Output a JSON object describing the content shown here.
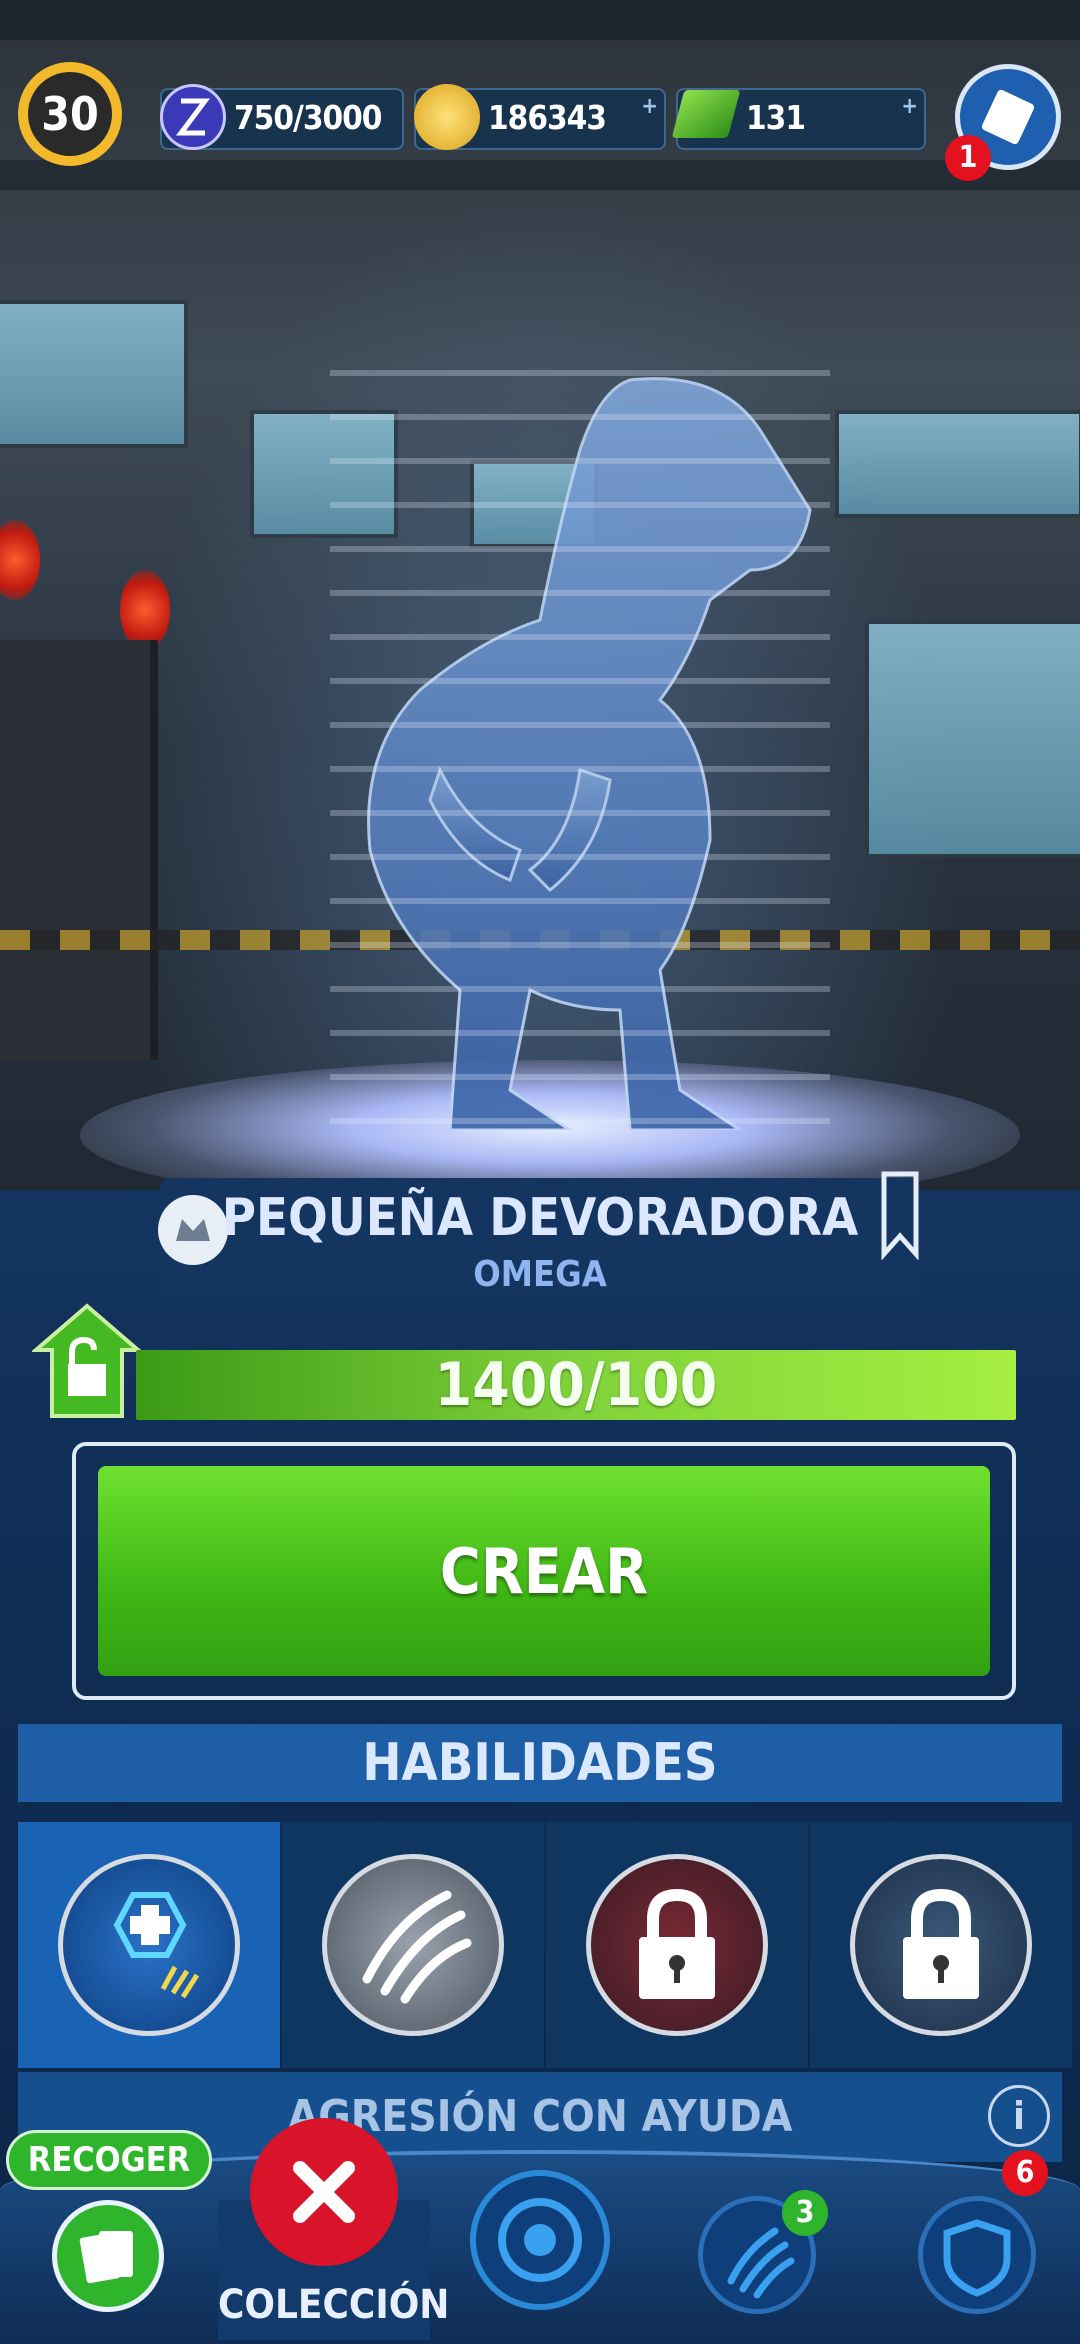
{
  "hud": {
    "level": "30",
    "dna": "750/3000",
    "coins": "186343",
    "cash": "131",
    "ticket_badge": "1"
  },
  "creature": {
    "name": "PEQUEÑA DEVORADORA",
    "rarity": "OMEGA"
  },
  "progress": {
    "text": "1400/100",
    "fraction": 1.0
  },
  "actions": {
    "create_label": "CREAR"
  },
  "abilities": {
    "header": "HABILIDADES",
    "selected_name": "AGRESIÓN CON AYUDA"
  },
  "bottom_nav": {
    "collect_label": "RECOGER",
    "collection_label": "COLECCIÓN",
    "battle_badge": "3",
    "shield_badge": "6"
  },
  "colors": {
    "accent_green": "#5ed122",
    "panel_blue": "#133560",
    "badge_red": "#e3121e",
    "badge_green": "#2fb52b"
  }
}
